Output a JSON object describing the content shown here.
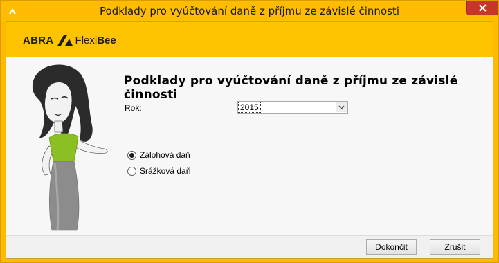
{
  "window": {
    "title": "Podklady pro vyúčtování daně z příjmu ze závislé činnosti",
    "close_icon": "close-icon"
  },
  "banner": {
    "logo_abra": "ABRA",
    "logo_flexi": "Flexi",
    "logo_bee": "Bee",
    "background_color": "#ffc300"
  },
  "form": {
    "heading": "Podklady pro vyúčtování daně z příjmu ze závislé činnosti",
    "year_label": "Rok:",
    "year_value": "2015",
    "radios": [
      {
        "label": "Zálohová daň",
        "checked": true
      },
      {
        "label": "Srážková daň",
        "checked": false
      }
    ]
  },
  "footer": {
    "finish_label": "Dokončit",
    "cancel_label": "Zrušit"
  }
}
